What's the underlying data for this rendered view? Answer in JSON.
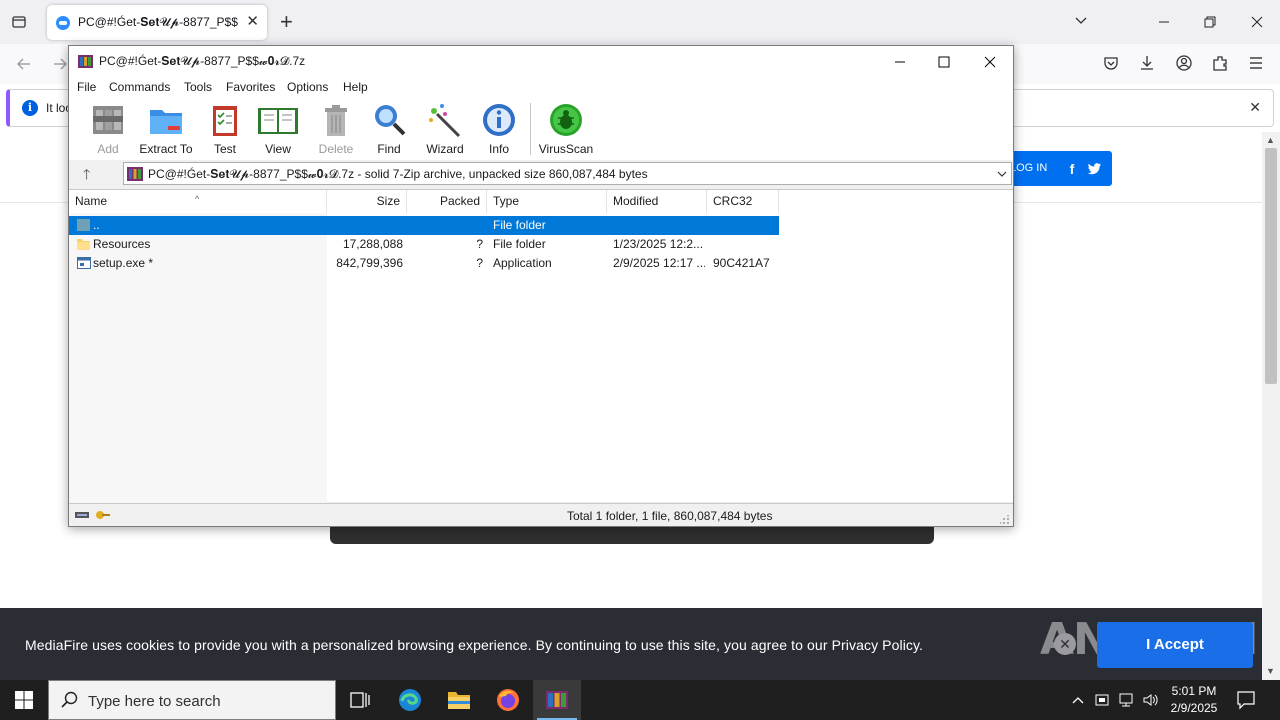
{
  "browser": {
    "tab_title": "PC@#!Ǵet-𝐒𝐞𝐭𝓤𝓹-8877_P$$",
    "tab_close": "✕",
    "new_tab": "+",
    "notification_text": "It loo",
    "notification_close": "✕"
  },
  "website": {
    "login_label": "LOG IN",
    "facebook_glyph": "f",
    "cookie_text": "MediaFire uses cookies to provide you with a personalized browsing experience. By continuing to use this site, you agree to our Privacy Policy.",
    "accept_label": "I Accept",
    "cookie_close": "✕",
    "watermark": "ANY RUN"
  },
  "winrar": {
    "title": "PC@#!Ǵet-𝐒𝐞𝐭𝓤𝓹-8877_P$$",
    "title_suffix": "𝔀𝟎𝓻𝓓.7z",
    "menu": [
      "File",
      "Commands",
      "Tools",
      "Favorites",
      "Options",
      "Help"
    ],
    "toolbar": {
      "add": "Add",
      "extract_to": "Extract To",
      "test": "Test",
      "view": "View",
      "delete": "Delete",
      "find": "Find",
      "wizard": "Wizard",
      "info": "Info",
      "virusscan": "VirusScan"
    },
    "address": "PC@#!Ǵet-𝐒𝐞𝐭𝓤𝓹-8877_P$$𝔀𝟎𝓻𝓓.7z - solid 7-Zip archive, unpacked size 860,087,484 bytes",
    "columns": {
      "name": "Name",
      "size": "Size",
      "packed": "Packed",
      "type": "Type",
      "modified": "Modified",
      "crc": "CRC32"
    },
    "rows": [
      {
        "name": "..",
        "size": "",
        "packed": "",
        "type": "File folder",
        "modified": "",
        "crc": ""
      },
      {
        "name": "Resources",
        "size": "17,288,088",
        "packed": "?",
        "type": "File folder",
        "modified": "1/23/2025 12:2...",
        "crc": ""
      },
      {
        "name": "setup.exe *",
        "size": "842,799,396",
        "packed": "?",
        "type": "Application",
        "modified": "2/9/2025 12:17 ...",
        "crc": "90C421A7"
      }
    ],
    "status": "Total 1 folder, 1 file, 860,087,484 bytes"
  },
  "taskbar": {
    "search_placeholder": "Type here to search",
    "time": "5:01 PM",
    "date": "2/9/2025"
  },
  "colors": {
    "selection": "#0078d7",
    "mediafire_blue": "#0070f0",
    "cookie_bg": "#2a2d33",
    "taskbar_bg": "#1f1f1f"
  }
}
